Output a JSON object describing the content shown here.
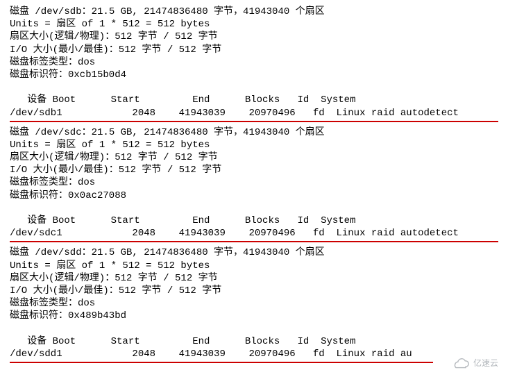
{
  "disks": [
    {
      "header": "磁盘 /dev/sdb：21.5 GB, 21474836480 字节，41943040 个扇区",
      "units": "Units = 扇区 of 1 * 512 = 512 bytes",
      "sector": "扇区大小(逻辑/物理)：512 字节 / 512 字节",
      "io": "I/O 大小(最小/最佳)：512 字节 / 512 字节",
      "labeltype": "磁盘标签类型：dos",
      "identifier": "磁盘标识符：0xcb15b0d4",
      "cols": "   设备 Boot      Start         End      Blocks   Id  System",
      "row": "/dev/sdb1            2048    41943039    20970496   fd  Linux raid autodetect"
    },
    {
      "header": "磁盘 /dev/sdc：21.5 GB, 21474836480 字节，41943040 个扇区",
      "units": "Units = 扇区 of 1 * 512 = 512 bytes",
      "sector": "扇区大小(逻辑/物理)：512 字节 / 512 字节",
      "io": "I/O 大小(最小/最佳)：512 字节 / 512 字节",
      "labeltype": "磁盘标签类型：dos",
      "identifier": "磁盘标识符：0x0ac27088",
      "cols": "   设备 Boot      Start         End      Blocks   Id  System",
      "row": "/dev/sdc1            2048    41943039    20970496   fd  Linux raid autodetect"
    },
    {
      "header": "磁盘 /dev/sdd：21.5 GB, 21474836480 字节，41943040 个扇区",
      "units": "Units = 扇区 of 1 * 512 = 512 bytes",
      "sector": "扇区大小(逻辑/物理)：512 字节 / 512 字节",
      "io": "I/O 大小(最小/最佳)：512 字节 / 512 字节",
      "labeltype": "磁盘标签类型：dos",
      "identifier": "磁盘标识符：0x489b43bd",
      "cols": "   设备 Boot      Start         End      Blocks   Id  System",
      "row": "/dev/sdd1            2048    41943039    20970496   fd  Linux raid au"
    }
  ],
  "watermark": "亿速云"
}
